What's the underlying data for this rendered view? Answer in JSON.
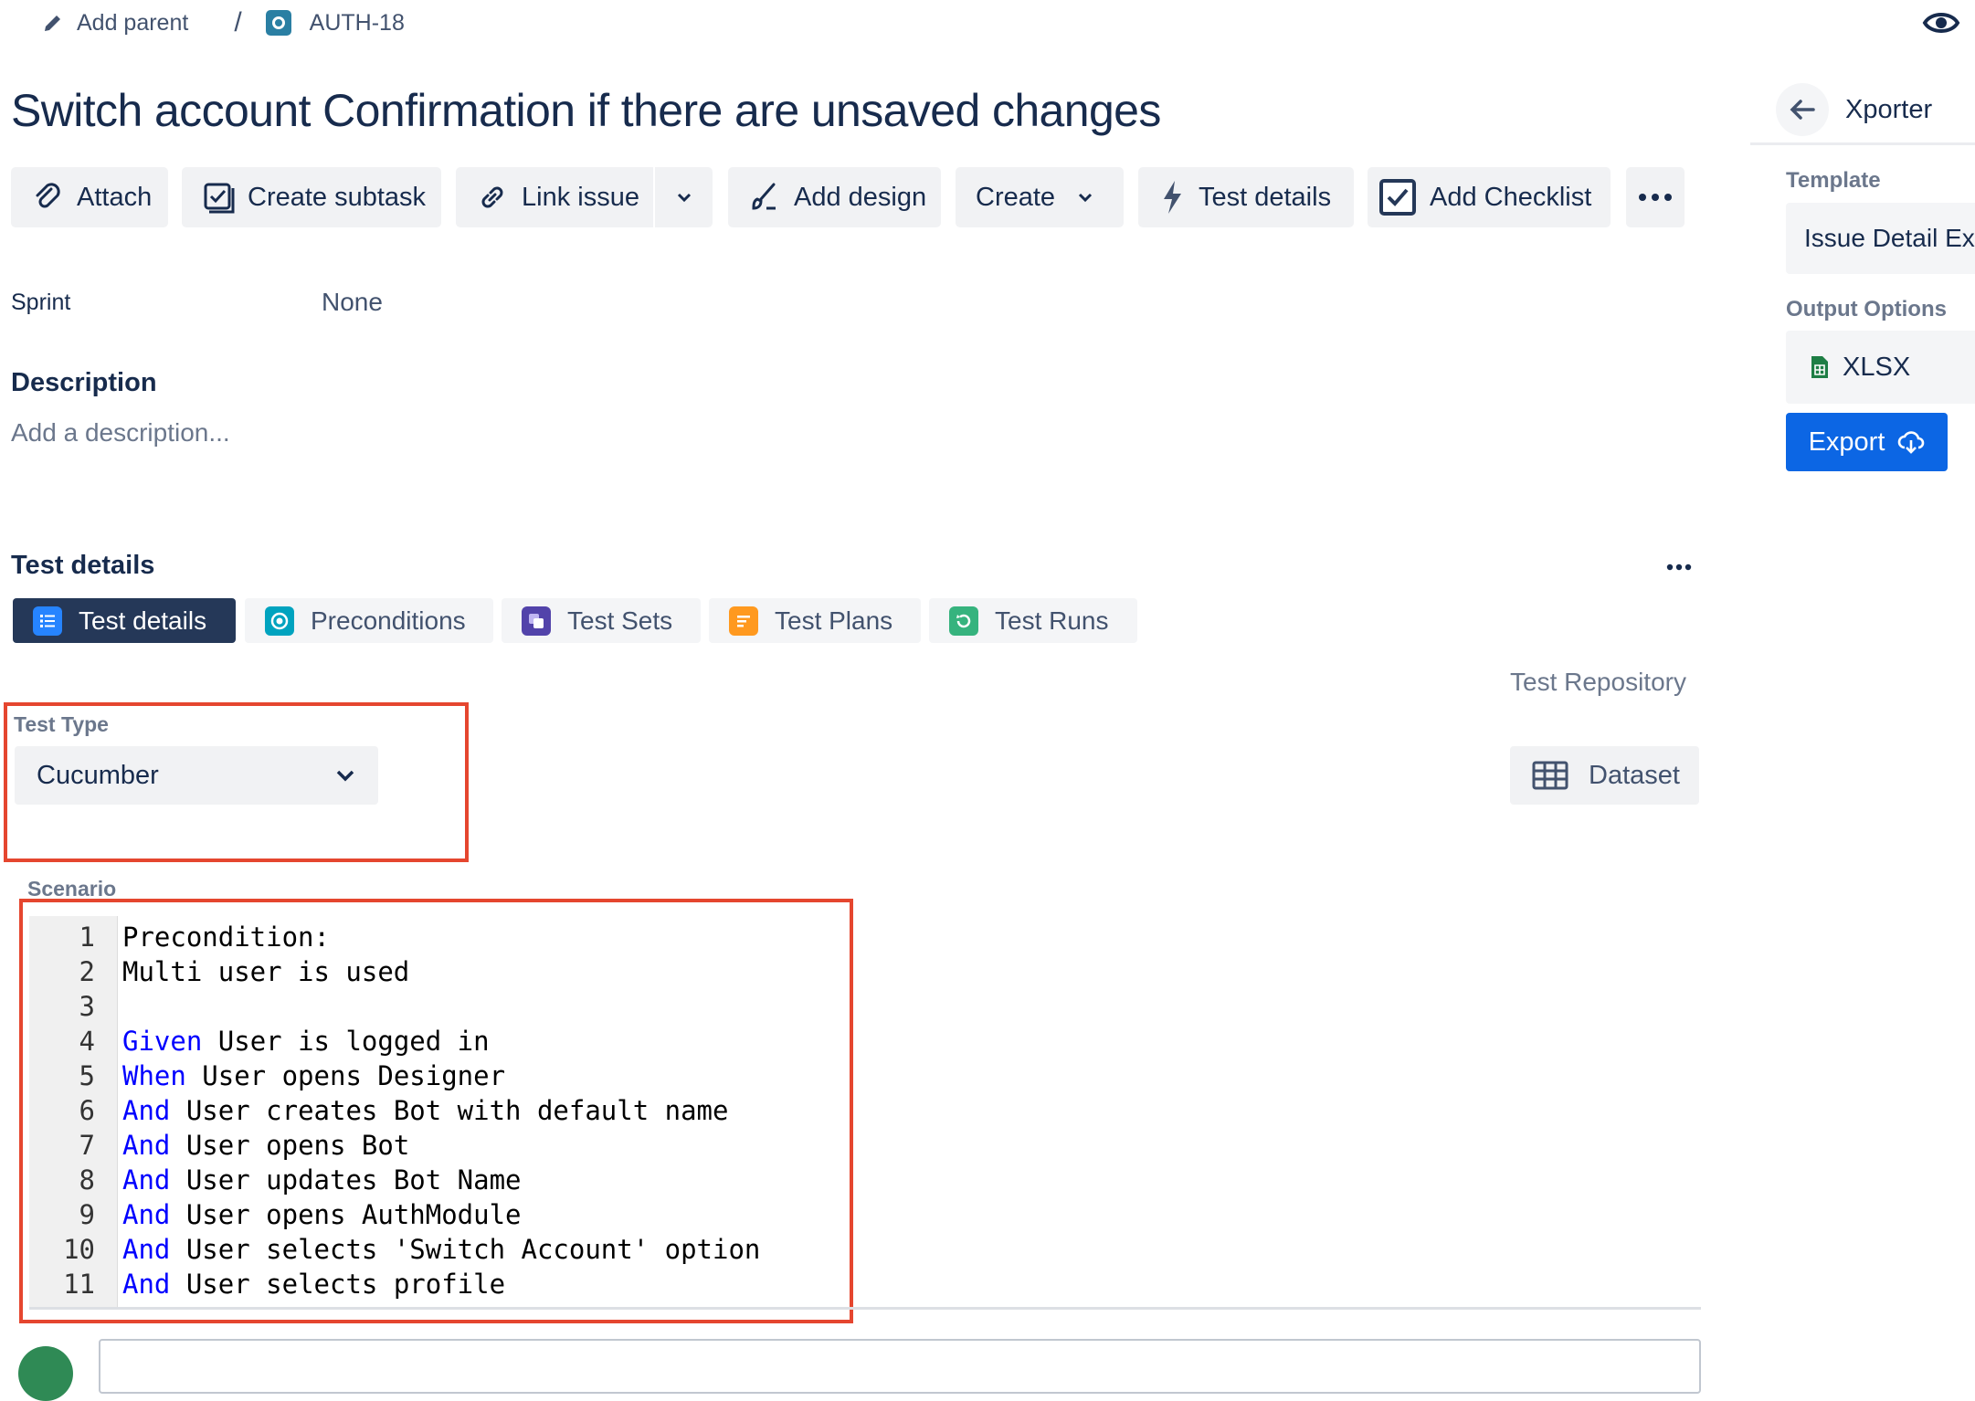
{
  "breadcrumb": {
    "add_parent": "Add parent",
    "separator": "/",
    "issue_key": "AUTH-18"
  },
  "issue": {
    "title": "Switch account Confirmation if there are unsaved changes"
  },
  "toolbar": {
    "attach": "Attach",
    "create_subtask": "Create subtask",
    "link_issue": "Link issue",
    "add_design": "Add design",
    "create": "Create",
    "test_details": "Test details",
    "add_checklist": "Add Checklist"
  },
  "fields": {
    "sprint_label": "Sprint",
    "sprint_value": "None"
  },
  "description": {
    "heading": "Description",
    "placeholder": "Add a description..."
  },
  "test_details": {
    "heading": "Test details",
    "tabs": [
      {
        "label": "Test details",
        "icon": "list-icon",
        "color": "#2684ff",
        "active": true
      },
      {
        "label": "Preconditions",
        "icon": "precondition-icon",
        "color": "#00a3bf",
        "active": false
      },
      {
        "label": "Test Sets",
        "icon": "test-set-icon",
        "color": "#5243aa",
        "active": false
      },
      {
        "label": "Test Plans",
        "icon": "test-plan-icon",
        "color": "#ff991f",
        "active": false
      },
      {
        "label": "Test Runs",
        "icon": "test-run-icon",
        "color": "#36b37e",
        "active": false
      }
    ],
    "test_repository": "Test Repository",
    "test_type_label": "Test Type",
    "test_type_value": "Cucumber",
    "dataset_button": "Dataset",
    "scenario_label": "Scenario",
    "scenario_lines": [
      {
        "n": "1",
        "kw": "",
        "text": "Precondition:"
      },
      {
        "n": "2",
        "kw": "",
        "text": "Multi user is used"
      },
      {
        "n": "3",
        "kw": "",
        "text": ""
      },
      {
        "n": "4",
        "kw": "Given",
        "text": " User is logged in"
      },
      {
        "n": "5",
        "kw": "When",
        "text": " User opens Designer"
      },
      {
        "n": "6",
        "kw": "And",
        "text": " User creates Bot with default name"
      },
      {
        "n": "7",
        "kw": "And",
        "text": " User opens Bot"
      },
      {
        "n": "8",
        "kw": "And",
        "text": " User updates Bot Name"
      },
      {
        "n": "9",
        "kw": "And",
        "text": " User opens AuthModule"
      },
      {
        "n": "10",
        "kw": "And",
        "text": " User selects 'Switch Account' option"
      },
      {
        "n": "11",
        "kw": "And",
        "text": " User selects profile"
      }
    ]
  },
  "xporter": {
    "title": "Xporter",
    "template_label": "Template",
    "template_value": "Issue Detail Ex",
    "output_label": "Output Options",
    "output_value": "XLSX",
    "export_button": "Export"
  },
  "colors": {
    "accent_blue": "#0c66e4",
    "highlight_red": "#e5462f",
    "keyword_blue": "#0000ff",
    "active_tab": "#253858"
  }
}
